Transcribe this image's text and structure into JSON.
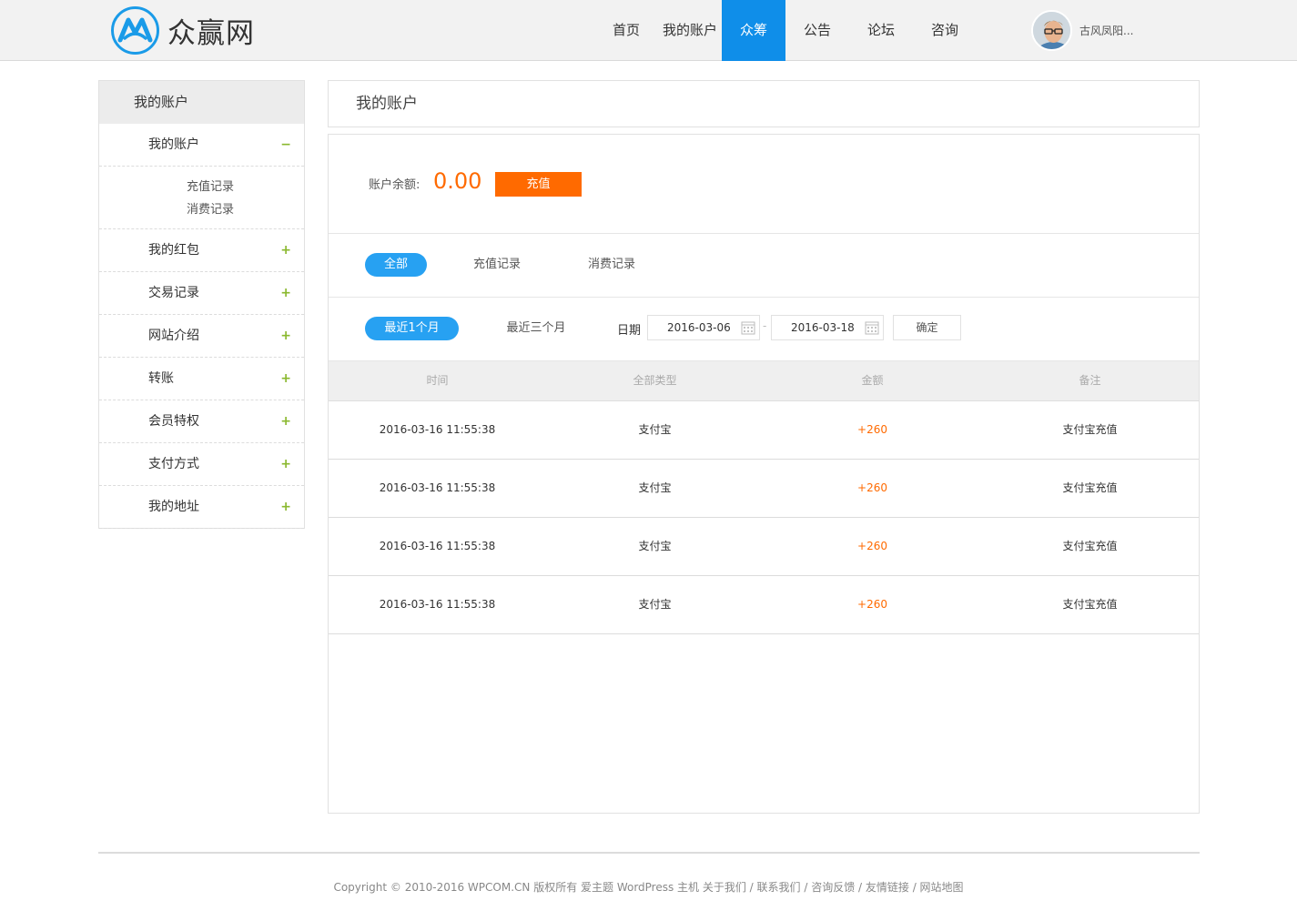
{
  "header": {
    "logo_text": "众赢网",
    "nav": [
      {
        "label": "首页",
        "active": false
      },
      {
        "label": "我的账户",
        "active": false
      },
      {
        "label": "众筹",
        "active": true
      },
      {
        "label": "公告",
        "active": false
      },
      {
        "label": "论坛",
        "active": false
      },
      {
        "label": "咨询",
        "active": false
      }
    ],
    "user_name": "古风凤阳..."
  },
  "sidebar": {
    "title": "我的账户",
    "items": [
      {
        "label": "我的账户",
        "toggle": "−"
      },
      {
        "label": "我的红包",
        "toggle": "+"
      },
      {
        "label": "交易记录",
        "toggle": "+"
      },
      {
        "label": "网站介绍",
        "toggle": "+"
      },
      {
        "label": "转账",
        "toggle": "+"
      },
      {
        "label": "会员特权",
        "toggle": "+"
      },
      {
        "label": "支付方式",
        "toggle": "+"
      },
      {
        "label": "我的地址",
        "toggle": "+"
      }
    ],
    "sub_items": [
      "充值记录",
      "消费记录"
    ]
  },
  "main": {
    "title": "我的账户",
    "balance_label": "账户余额:",
    "balance_value": "0.00",
    "recharge_label": "充值",
    "type_tabs": [
      "全部",
      "充值记录",
      "消费记录"
    ],
    "range_tabs": [
      "最近1个月",
      "最近三个月"
    ],
    "date_label": "日期",
    "date_from": "2016-03-06",
    "date_to": "2016-03-18",
    "date_sep": "-",
    "confirm_label": "确定",
    "table": {
      "headers": [
        "时间",
        "全部类型",
        "金额",
        "备注"
      ],
      "rows": [
        [
          "2016-03-16 11:55:38",
          "支付宝",
          "+260",
          "支付宝充值"
        ],
        [
          "2016-03-16 11:55:38",
          "支付宝",
          "+260",
          "支付宝充值"
        ],
        [
          "2016-03-16 11:55:38",
          "支付宝",
          "+260",
          "支付宝充值"
        ],
        [
          "2016-03-16 11:55:38",
          "支付宝",
          "+260",
          "支付宝充值"
        ]
      ]
    }
  },
  "colors": {
    "accent_blue": "#0f8ee9",
    "pill_blue": "#27a1f2",
    "orange": "#ff6a00",
    "plus_green": "#8ab82e"
  },
  "footer": {
    "text": "Copyright © 2010-2016 WPCOM.CN 版权所有 爱主题 WordPress 主机 关于我们 / 联系我们 / 咨询反馈 / 友情链接 / 网站地图"
  }
}
